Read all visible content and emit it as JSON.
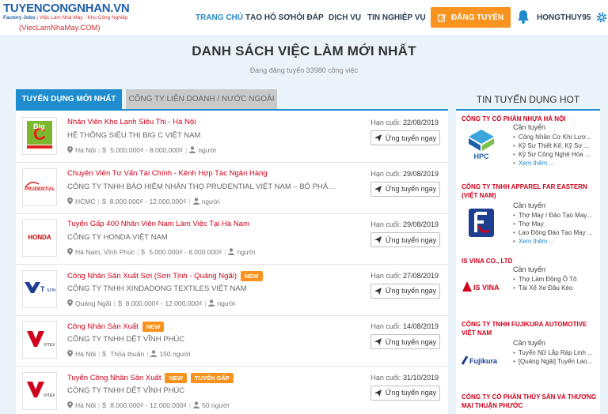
{
  "header": {
    "logo_main": "TUYENCONGNHAN.VN",
    "logo_sub_bold": "Factory Jobs",
    "logo_sub": "| Việc Làm Nhà Máy - Khu Công Nghiệp",
    "logo_url": "(ViecLamNhaMay.COM)",
    "nav": [
      "TRANG CHỦ",
      "TẠO HỒ SƠ",
      "HỎI ĐÁP",
      "DỊCH VỤ",
      "TIN NGHIỆP VỤ"
    ],
    "post_button": "ĐĂNG TUYỂN",
    "username": "HONGTHUY95"
  },
  "page": {
    "title": "DANH SÁCH VIỆC LÀM MỚI NHẤT",
    "subtitle": "Đang đăng tuyển 33980 công việc"
  },
  "tabs": [
    "TUYỂN DỤNG MỚI NHẤT",
    "CÔNG TY LIÊN DOANH / NƯỚC NGOÀI"
  ],
  "apply_label": "Ứng tuyển ngay",
  "deadline_label": "Hạn cuối:",
  "jobs": [
    {
      "title": "Nhân Viên Kho Lạnh Siêu Thị - Hà Nội",
      "badges": [],
      "company": "HỆ THỐNG SIÊU THỊ BIG C VIỆT NAM",
      "location": "Hà Nội",
      "salary": "5.000.000₫ - 8.000.000₫",
      "people": "người",
      "deadline": "22/08/2019",
      "logo": "big-c-logo"
    },
    {
      "title": "Chuyên Viên Tư Vấn Tài Chính - Kênh Hợp Tác Ngân Hàng",
      "badges": [],
      "company": "CÔNG TY TNHH BẢO HIỂM NHÂN THỌ PRUDENTIAL VIỆT NAM – BỘ PHẬN HỢP T...",
      "location": "HCMC",
      "salary": "8.000.000₫ - 12.000.000₫",
      "people": "người",
      "deadline": "29/08/2019",
      "logo": "prudential-logo"
    },
    {
      "title": "Tuyển Gấp 400 Nhân Viên Nam Làm Việc Tại Hà Nam",
      "badges": [],
      "company": "CÔNG TY HONDA VIỆT NAM",
      "location": "Hà Nam, Vĩnh Phúc",
      "salary": "5.000.000₫ - 8.000.000₫",
      "people": "người",
      "deadline": "29/08/2019",
      "logo": "honda-logo"
    },
    {
      "title": "Công Nhân Sản Xuất Sợi (Sơn Tịnh - Quảng Ngãi)",
      "badges": [
        "NEW"
      ],
      "company": "CÔNG TY TNHH XINDADONG TEXTILES VIỆT NAM",
      "location": "Quảng Ngãi",
      "salary": "8.000.000₫ - 12.000.000₫",
      "people": "người",
      "deadline": "27/08/2019",
      "logo": "xindadong-logo"
    },
    {
      "title": "Công Nhân Sản Xuất",
      "badges": [
        "NEW"
      ],
      "company": "CÔNG TY TNHH DỆT VĨNH PHÚC",
      "location": "Hà Nội",
      "salary": "Thỏa thuận",
      "people": "150 người",
      "deadline": "14/08/2019",
      "logo": "vitex-logo"
    },
    {
      "title": "Tuyển Công Nhân Sản Xuất",
      "badges": [
        "NEW",
        "TUYỂN GẤP"
      ],
      "company": "CÔNG TY TNHH DỆT VĨNH PHÚC",
      "location": "Hà Nội",
      "salary": "8.000.000₫ - 12.000.000₫",
      "people": "50 người",
      "deadline": "31/10/2019",
      "logo": "vitex-logo"
    }
  ],
  "hot": {
    "title": "TIN TUYỂN DỤNG HOT",
    "need_label": "Cần tuyển",
    "more_label": "Xem thêm ...",
    "items": [
      {
        "company": "CÔNG TY CỔ PHẦN NHỰA HÀ NỘI",
        "jobs": [
          "Công Nhân Cơ Khí Lươ...",
          "Kỹ Sư Thiết Kế, Kỹ Sư ...",
          "Kỹ Sư Công Nghệ Hóa ..."
        ],
        "more": true,
        "logo": "hpc-logo",
        "logo_text": "HPC"
      },
      {
        "company": "CÔNG TY TNHH APPAREL FAR EASTERN (VIỆT NAM)",
        "jobs": [
          "Thợ May / Đảo Tạo May...",
          "Thợ May",
          "Lao Động Đào Tạo May ..."
        ],
        "more": true,
        "logo": "far-eastern-logo",
        "logo_text": ""
      },
      {
        "company": "IS VINA CO., LTD",
        "jobs": [
          "Thợ Làm Đồng Ô Tô",
          "Tài Xế Xe Đầu Kéo"
        ],
        "more": false,
        "logo": "isvina-logo",
        "logo_text": "IS VINA"
      },
      {
        "company": "CÔNG TY TNHH FUJIKURA AUTOMOTIVE VIỆT NAM",
        "jobs": [
          "Tuyển Nữ Lắp Ráp Linh ...",
          "[Quảng Ngãi] Tuyển Lao..."
        ],
        "more": false,
        "logo": "fujikura-logo",
        "logo_text": "Fujikura"
      },
      {
        "company": "CÔNG TY CỔ PHẦN THỦY SẢN VÀ THƯƠNG MẠI THUẬN PHƯỚC",
        "jobs": [],
        "more": false,
        "logo": "",
        "logo_text": ""
      }
    ]
  },
  "colors": {
    "accent": "#1f8ccf",
    "job_title": "#d0021b",
    "badge": "#f7931e",
    "post_button": "#f7931e"
  }
}
